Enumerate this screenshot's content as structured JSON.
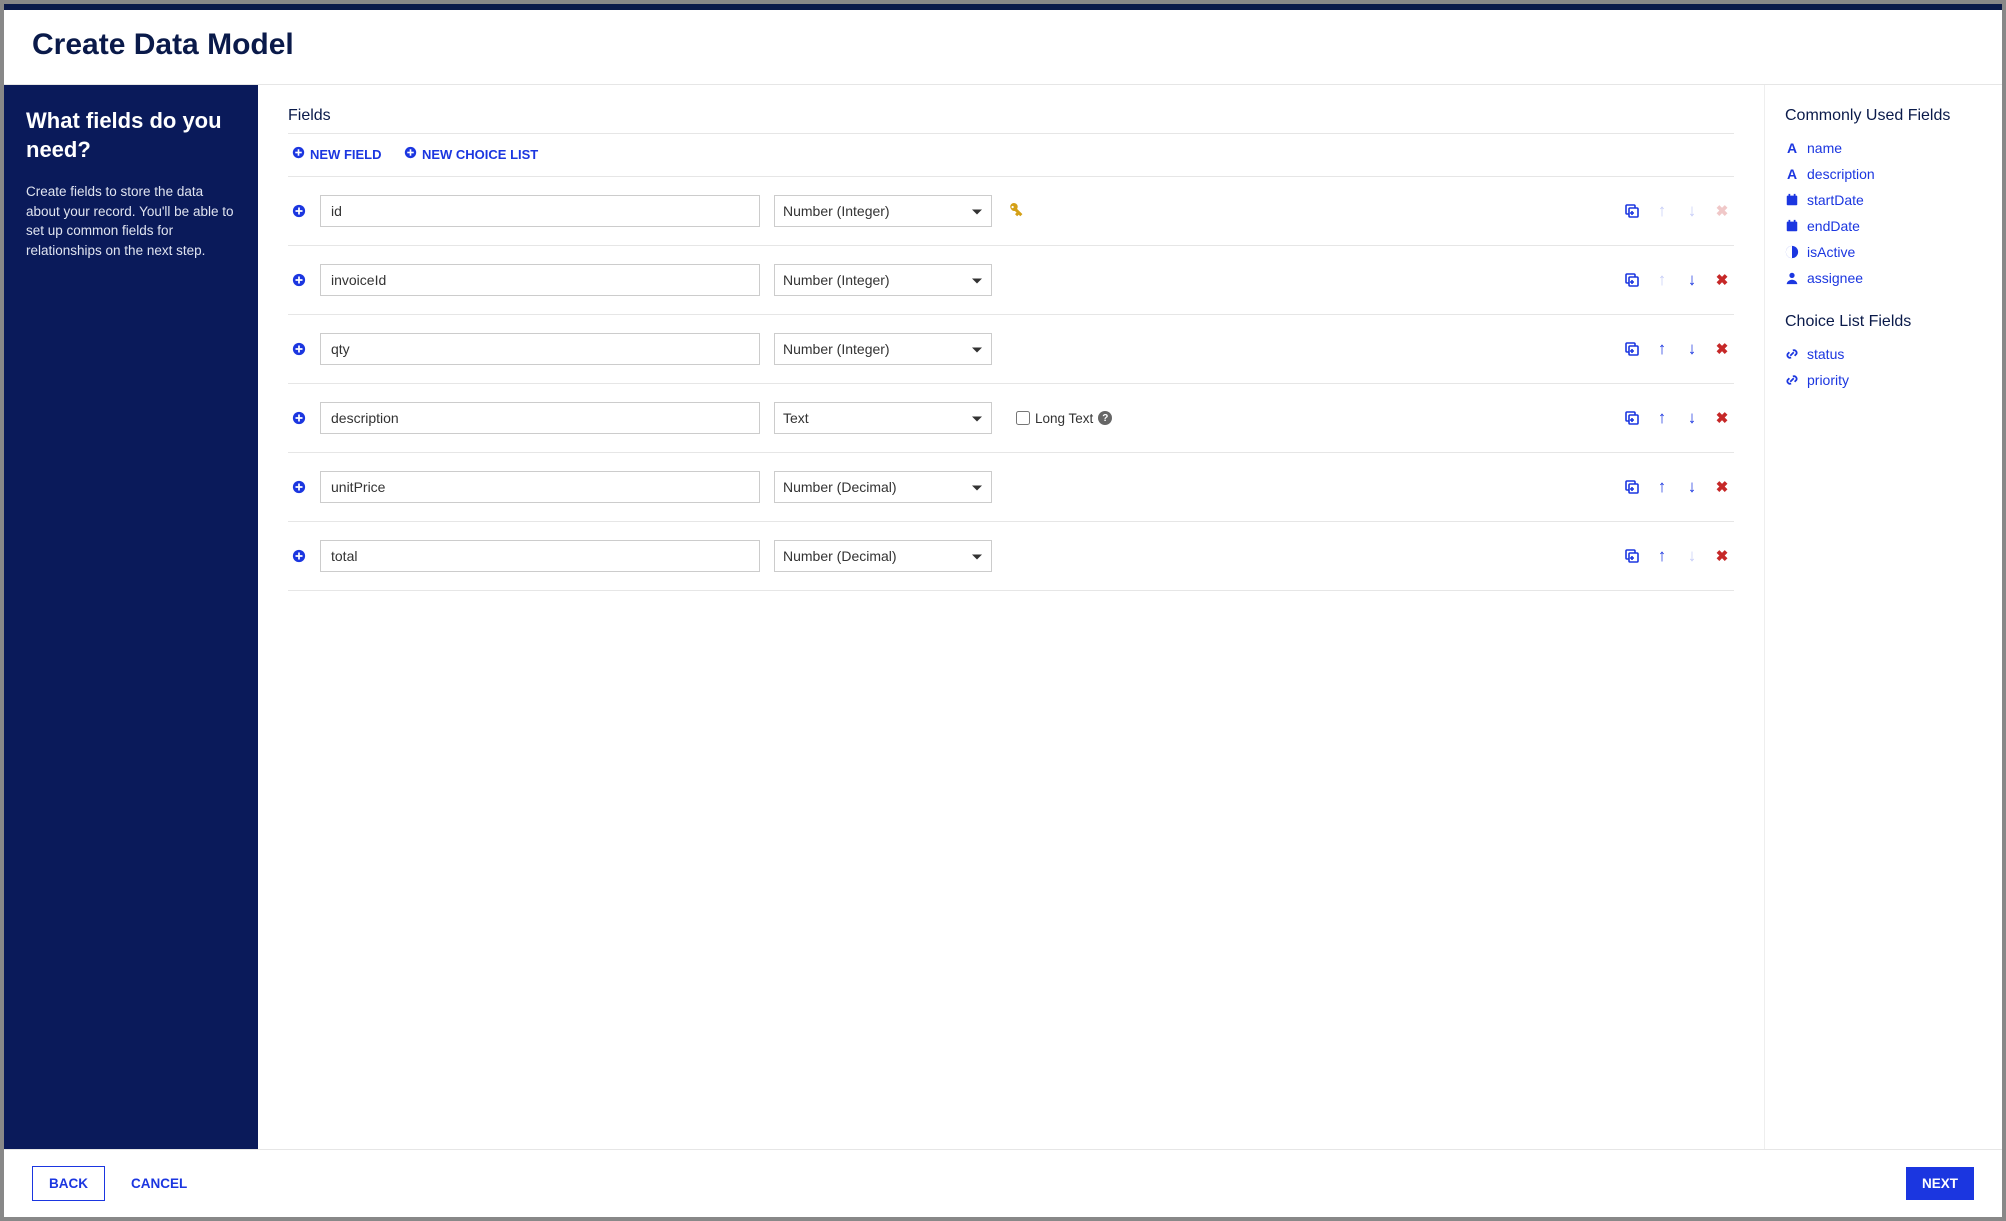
{
  "header": {
    "title": "Create Data Model"
  },
  "sidebar": {
    "question": "What fields do you need?",
    "helptext": "Create fields to store the data about your record. You'll be able to set up common fields for relationships on the next step."
  },
  "fieldsSection": {
    "title": "Fields",
    "newFieldLabel": "NEW FIELD",
    "newChoiceListLabel": "NEW CHOICE LIST",
    "longTextLabel": "Long Text"
  },
  "fields": [
    {
      "name": "id",
      "type": "Number (Integer)",
      "isKey": true,
      "showLongText": false,
      "upEnabled": false,
      "downEnabled": false,
      "removeEnabled": false
    },
    {
      "name": "invoiceId",
      "type": "Number (Integer)",
      "isKey": false,
      "showLongText": false,
      "upEnabled": false,
      "downEnabled": true,
      "removeEnabled": true
    },
    {
      "name": "qty",
      "type": "Number (Integer)",
      "isKey": false,
      "showLongText": false,
      "upEnabled": true,
      "downEnabled": true,
      "removeEnabled": true
    },
    {
      "name": "description",
      "type": "Text",
      "isKey": false,
      "showLongText": true,
      "upEnabled": true,
      "downEnabled": true,
      "removeEnabled": true
    },
    {
      "name": "unitPrice",
      "type": "Number (Decimal)",
      "isKey": false,
      "showLongText": false,
      "upEnabled": true,
      "downEnabled": true,
      "removeEnabled": true
    },
    {
      "name": "total",
      "type": "Number (Decimal)",
      "isKey": false,
      "showLongText": false,
      "upEnabled": true,
      "downEnabled": false,
      "removeEnabled": true
    }
  ],
  "commonFields": {
    "title": "Commonly Used Fields",
    "items": [
      {
        "label": "name",
        "icon": "text"
      },
      {
        "label": "description",
        "icon": "text"
      },
      {
        "label": "startDate",
        "icon": "calendar"
      },
      {
        "label": "endDate",
        "icon": "calendar"
      },
      {
        "label": "isActive",
        "icon": "boolean"
      },
      {
        "label": "assignee",
        "icon": "user"
      }
    ]
  },
  "choiceFields": {
    "title": "Choice List Fields",
    "items": [
      {
        "label": "status",
        "icon": "link"
      },
      {
        "label": "priority",
        "icon": "link"
      }
    ]
  },
  "footer": {
    "back": "BACK",
    "cancel": "CANCEL",
    "next": "NEXT"
  }
}
